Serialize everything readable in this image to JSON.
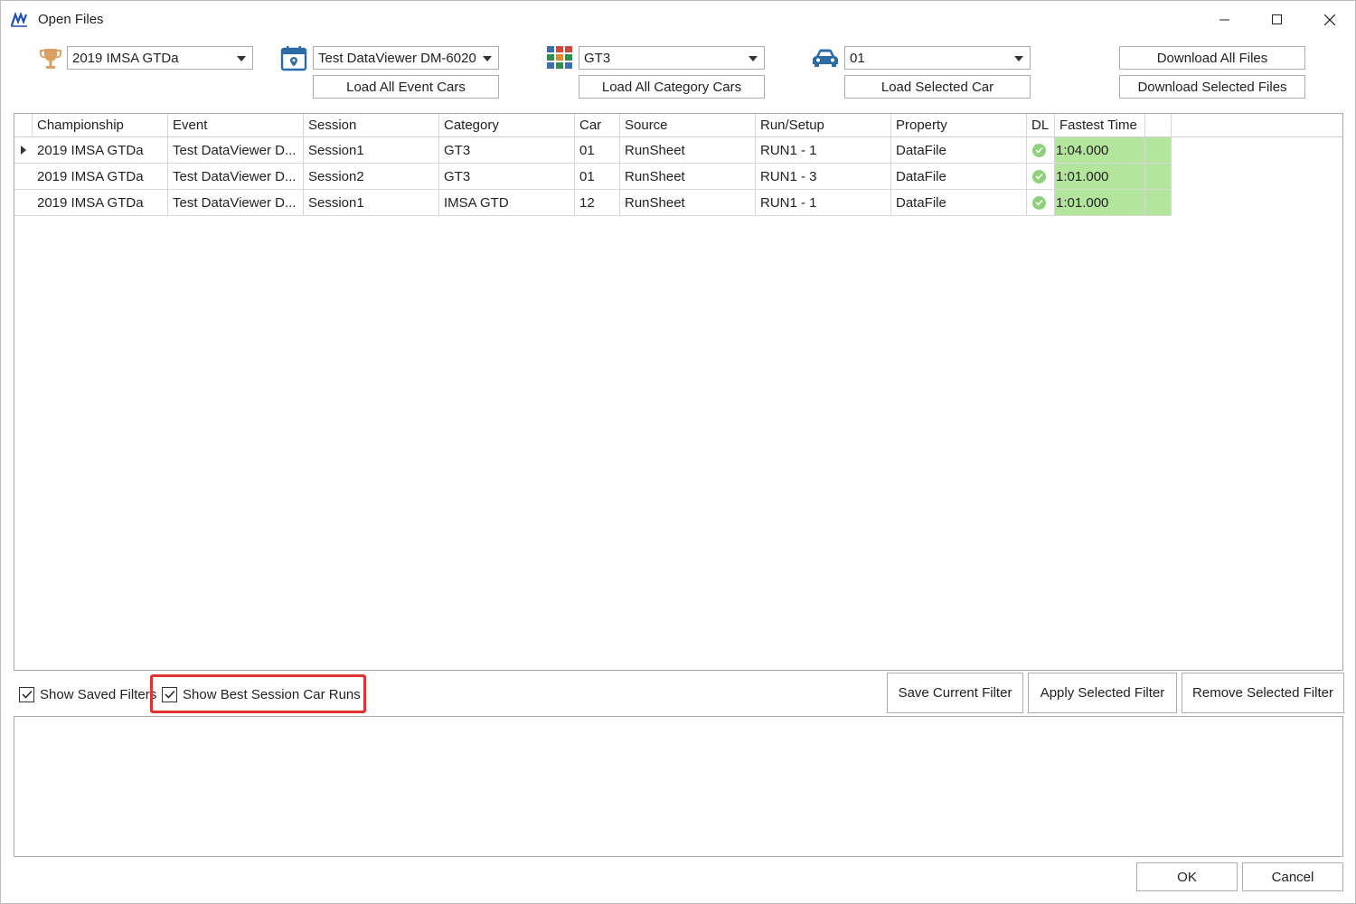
{
  "window": {
    "title": "Open Files"
  },
  "toolbar": {
    "championship": {
      "icon": "trophy-icon",
      "value": "2019 IMSA GTDa"
    },
    "event": {
      "icon": "calendar-pin-icon",
      "value": "Test DataViewer DM-6020",
      "load_button": "Load All Event Cars"
    },
    "category": {
      "icon": "color-grid-icon",
      "value": "GT3",
      "load_button": "Load All Category Cars"
    },
    "car": {
      "icon": "car-icon",
      "value": "01",
      "load_button": "Load Selected Car"
    },
    "download_all": "Download All Files",
    "download_selected": "Download Selected Files"
  },
  "grid": {
    "columns": [
      "Championship",
      "Event",
      "Session",
      "Category",
      "Car",
      "Source",
      "Run/Setup",
      "Property",
      "DL",
      "Fastest Time",
      ""
    ],
    "rows": [
      [
        "2019 IMSA GTDa",
        "Test DataViewer D...",
        "Session1",
        "GT3",
        "01",
        "RunSheet",
        "RUN1 - 1",
        "DataFile",
        "check",
        "1:04.000",
        ""
      ],
      [
        "2019 IMSA GTDa",
        "Test DataViewer D...",
        "Session2",
        "GT3",
        "01",
        "RunSheet",
        "RUN1 - 3",
        "DataFile",
        "check",
        "1:01.000",
        ""
      ],
      [
        "2019 IMSA GTDa",
        "Test DataViewer D...",
        "Session1",
        "IMSA GTD",
        "12",
        "RunSheet",
        "RUN1 - 1",
        "DataFile",
        "check",
        "1:01.000",
        ""
      ]
    ],
    "highlight_color": "#b3e59c"
  },
  "filters": {
    "show_saved_filters": {
      "label": "Show Saved Filters",
      "checked": true
    },
    "show_best_session": {
      "label": "Show Best Session Car Runs",
      "checked": true
    },
    "save_current": "Save Current Filter",
    "apply_selected": "Apply Selected Filter",
    "remove_selected": "Remove Selected Filter"
  },
  "dialog": {
    "ok": "OK",
    "cancel": "Cancel"
  },
  "colors": {
    "annotation_red": "#e2322f",
    "dl_check": "#8fd17a"
  }
}
